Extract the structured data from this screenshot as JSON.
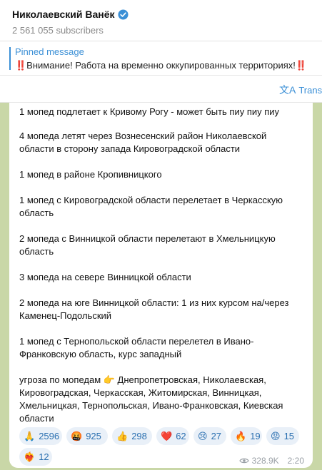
{
  "channel": {
    "title": "Николаевский Ванёк",
    "subscribers": "2 561 055 subscribers"
  },
  "pinned": {
    "label": "Pinned message",
    "text": "‼️Внимание! Работа на временно оккупированных территориях!‼️"
  },
  "translate": {
    "label": "Translate"
  },
  "message": {
    "lines": [
      "1 мопед подлетает к Кривому Рогу - может быть пиу пиу пиу",
      "4 мопеда летят через Вознесенский район Николаевской",
      "области в сторону запада Кировоградской области",
      "1 мопед в районе Кропивницкого",
      "1 мопед с Кировоградской области перелетает в Черкасскую",
      "область",
      "2 мопеда с Винницкой области перелетают в Хмельницкую",
      "область",
      "3 мопеда на севере Винницкой области",
      "2 мопеда на юге Винницкой области: 1 из них курсом на/через",
      "Каменец-Подольский",
      "1 мопед с Тернопольской области перелетел в Ивано-",
      "Франковскую область, курс западный",
      "угроза по мопедам 👉 Днепропетровская, Николаевская,",
      "Кировоградская, Черкасская, Житомирская, Винницкая,",
      "Хмельницкая, Тернопольская, Ивано-Франковская, Киевская",
      "области"
    ],
    "reactions": [
      {
        "emoji": "🙏",
        "count": "2596"
      },
      {
        "emoji": "🤬",
        "count": "925"
      },
      {
        "emoji": "👍",
        "count": "298"
      },
      {
        "emoji": "❤️",
        "count": "62"
      },
      {
        "emoji": "😢",
        "count": "27"
      },
      {
        "emoji": "🔥",
        "count": "19"
      },
      {
        "emoji": "😡",
        "count": "15"
      },
      {
        "emoji": "❤️‍🔥",
        "count": "12"
      }
    ],
    "views": "328.9K",
    "time": "2:20"
  }
}
